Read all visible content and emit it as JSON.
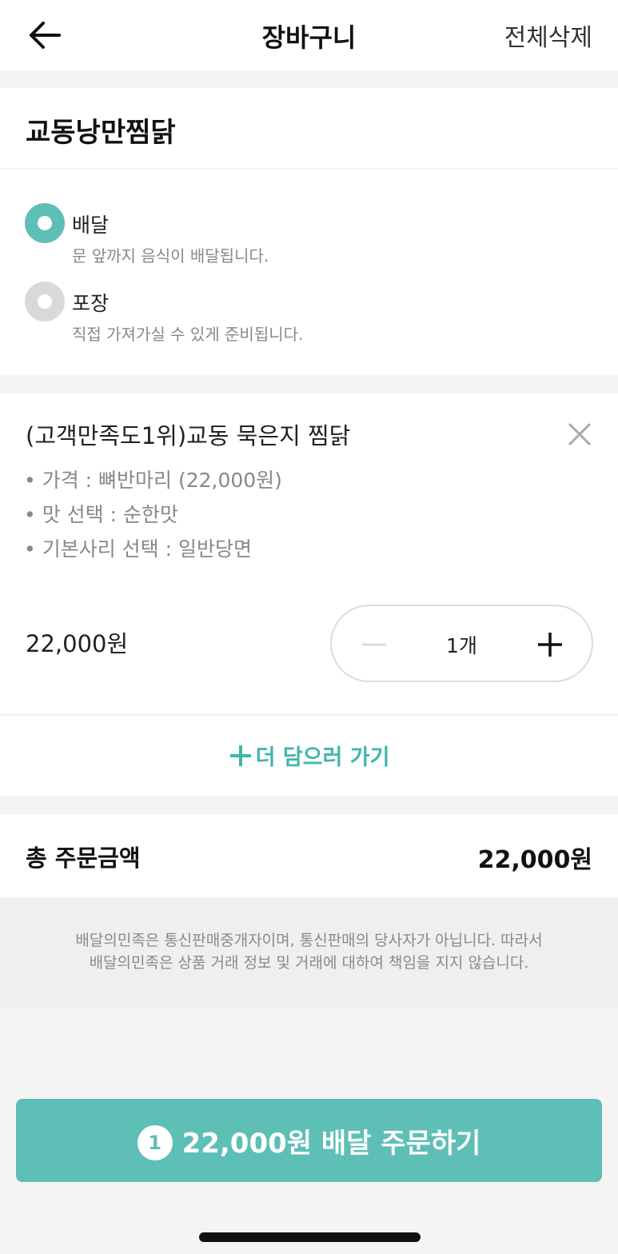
{
  "colors": {
    "accent": "#5ebfb6",
    "accent_text": "#3fb6ac",
    "radio_off": "#d9d9d9"
  },
  "header": {
    "title": "장바구니",
    "delete_all_label": "전체삭제",
    "back_icon": "arrow-left-icon"
  },
  "store": {
    "name": "교동낭만찜닭"
  },
  "order_type": {
    "options": [
      {
        "label": "배달",
        "description": "문 앞까지 음식이 배달됩니다.",
        "selected": true
      },
      {
        "label": "포장",
        "description": "직접 가져가실 수 있게 준비됩니다.",
        "selected": false
      }
    ]
  },
  "cart_item": {
    "name": "(고객만족도1위)교동 묵은지 찜닭",
    "options": [
      "• 가격 : 뼈반마리 (22,000원)",
      "• 맛 선택 : 순한맛",
      "• 기본사리 선택 : 일반당면"
    ],
    "price": "22,000원",
    "quantity_label": "1개"
  },
  "add_more": {
    "label": "더 담으러 가기"
  },
  "total": {
    "label": "총 주문금액",
    "value": "22,000원"
  },
  "notice": {
    "line1": "배달의민족은 통신판매중개자이며, 통신판매의 당사자가 아닙니다. 따라서",
    "line2": "배달의민족은 상품 거래 정보 및 거래에 대하여 책임을 지지 않습니다."
  },
  "order_button": {
    "count": "1",
    "label": "22,000원 배달 주문하기"
  }
}
